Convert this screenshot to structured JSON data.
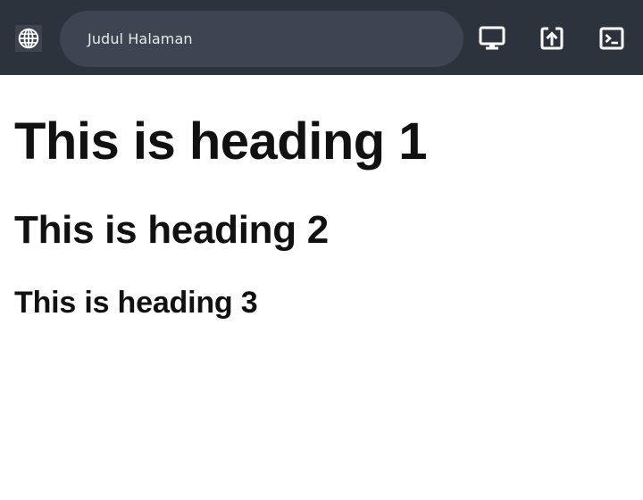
{
  "toolbar": {
    "site_icon": "globe-icon",
    "page_title": "Judul Halaman",
    "actions": [
      {
        "icon": "desktop-icon"
      },
      {
        "icon": "open-in-new-icon"
      },
      {
        "icon": "terminal-icon"
      }
    ],
    "colors": {
      "background": "#2d333d",
      "address_bar": "#3e4450",
      "icon": "#ffffff",
      "text": "#e7e9ec"
    }
  },
  "page": {
    "heading1": "This is heading 1",
    "heading2": "This is heading 2",
    "heading3": "This is heading 3",
    "text_color": "#111111",
    "background": "#ffffff"
  }
}
